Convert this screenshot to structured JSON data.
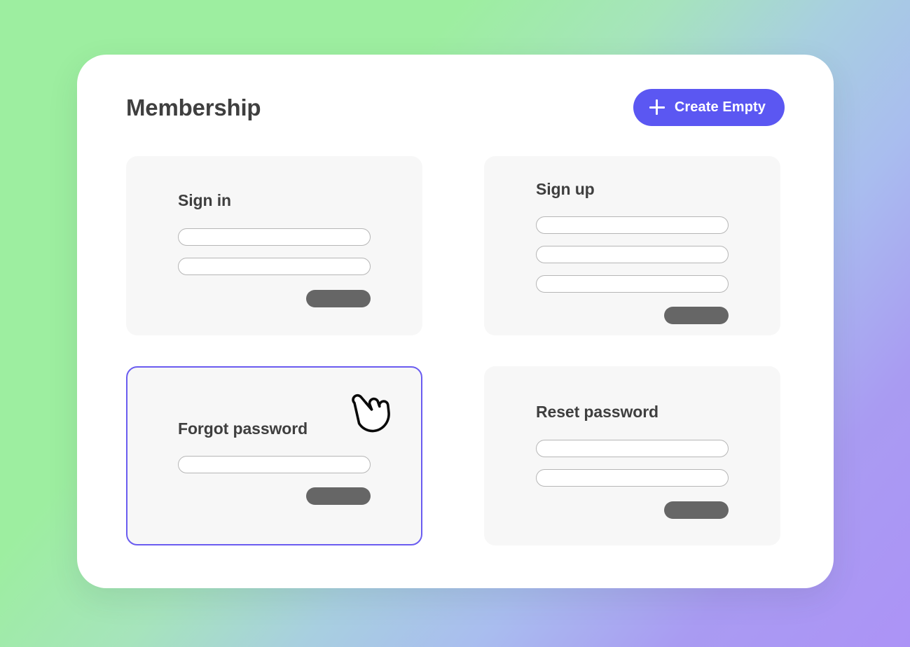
{
  "background": {
    "gradient_from": "#9DEEA0",
    "gradient_to": "#AC93F6"
  },
  "header": {
    "title": "Membership",
    "create_button": {
      "label": "Create Empty",
      "icon": "plus-icon",
      "color": "#5B57F2",
      "text_color": "#FFFFFF"
    }
  },
  "theme": {
    "panel_background": "#FFFFFF",
    "card_background": "#F7F7F7",
    "card_title_color": "#3F3F3F",
    "field_border_color": "#B6B6B6",
    "field_background": "#FFFFFF",
    "submit_color": "#666666",
    "selection_color": "#6A5CF0"
  },
  "cursor": {
    "icon": "pointing-hand-cursor",
    "on_card": "forgot-password"
  },
  "cards": [
    {
      "id": "sign-in",
      "title": "Sign in",
      "fields": 2,
      "has_submit": true,
      "selected": false
    },
    {
      "id": "sign-up",
      "title": "Sign up",
      "fields": 3,
      "has_submit": true,
      "selected": false
    },
    {
      "id": "forgot-password",
      "title": "Forgot password",
      "fields": 1,
      "has_submit": true,
      "selected": true
    },
    {
      "id": "reset-password",
      "title": "Reset password",
      "fields": 2,
      "has_submit": true,
      "selected": false
    }
  ]
}
